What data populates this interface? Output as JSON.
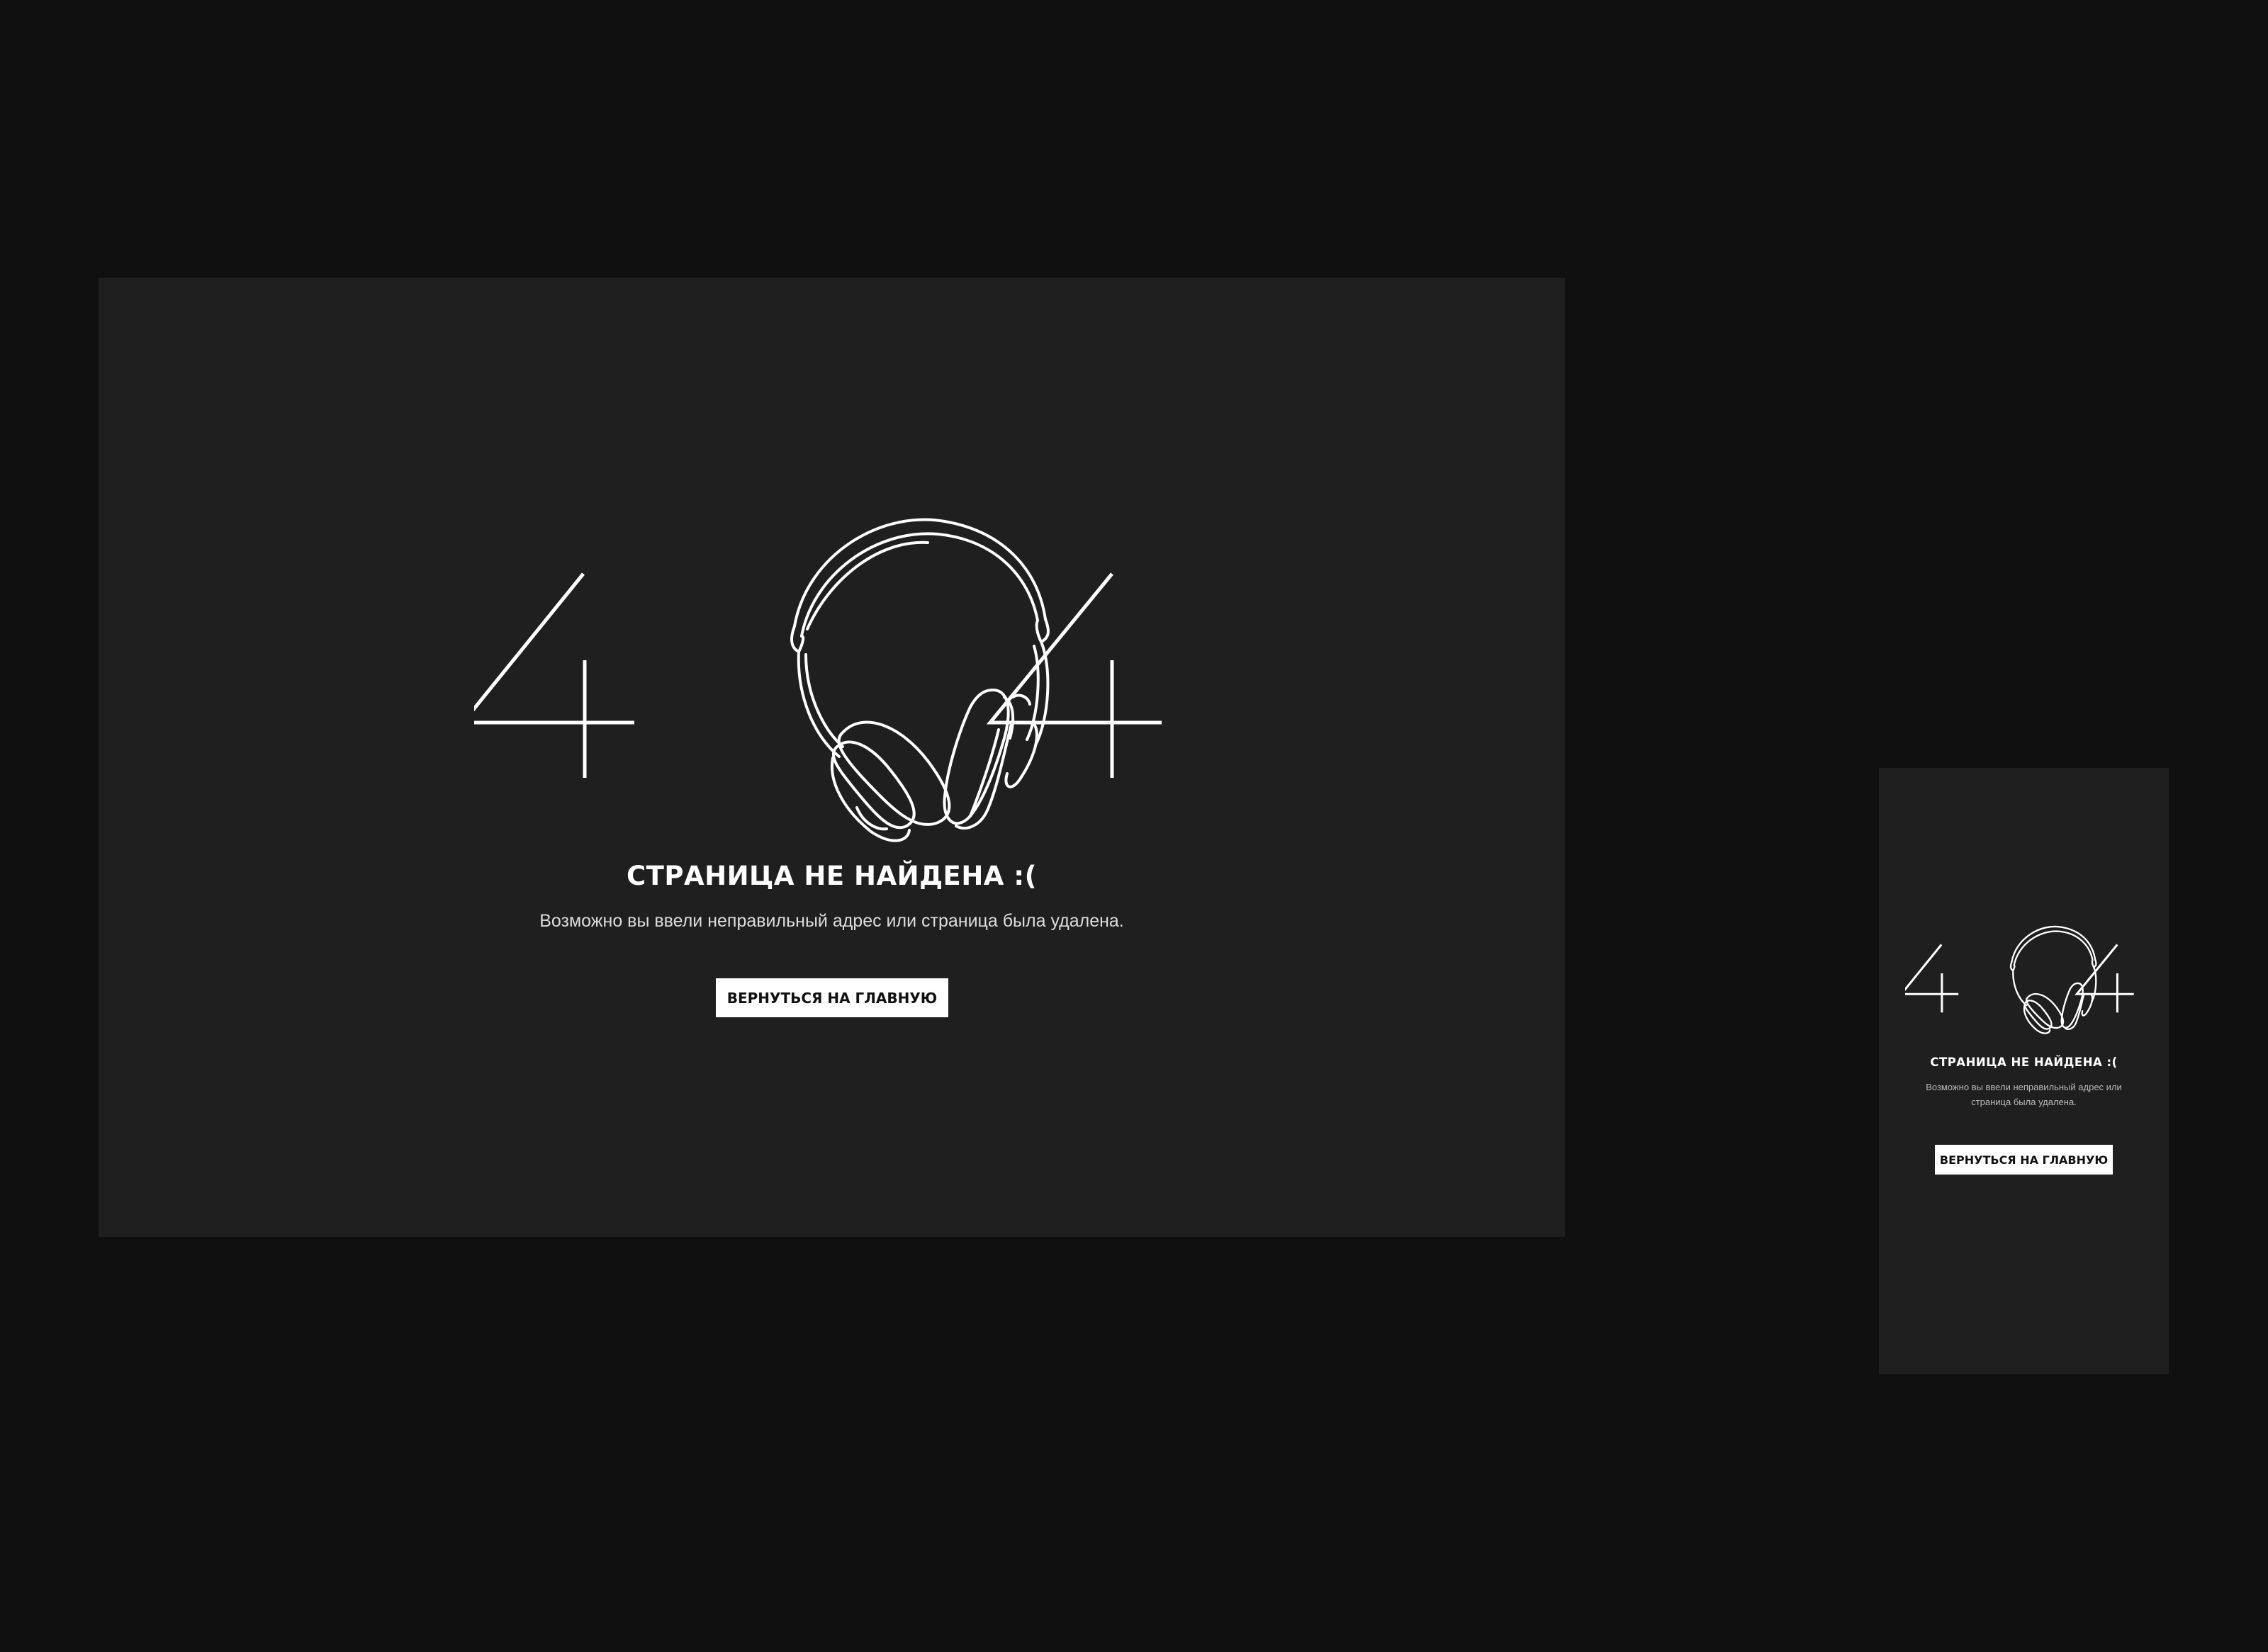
{
  "desktop": {
    "title": "СТРАНИЦА НЕ НАЙДЕНА :(",
    "subtitle": "Возможно вы ввели неправильный адрес или страница была удалена.",
    "button_label": "ВЕРНУТЬСЯ НА ГЛАВНУЮ"
  },
  "mobile": {
    "title": "СТРАНИЦА НЕ НАЙДЕНА :(",
    "subtitle": "Возможно вы ввели неправильный адрес или страница была удалена.",
    "button_label": "ВЕРНУТЬСЯ НА ГЛАВНУЮ"
  },
  "illustration": {
    "left_digit": "4",
    "right_digit": "4",
    "center_icon": "headphones-icon"
  },
  "colors": {
    "page_background": "#101010",
    "frame_background": "#1f1f1f",
    "text": "#ffffff",
    "button_background": "#ffffff",
    "button_text": "#111111"
  }
}
